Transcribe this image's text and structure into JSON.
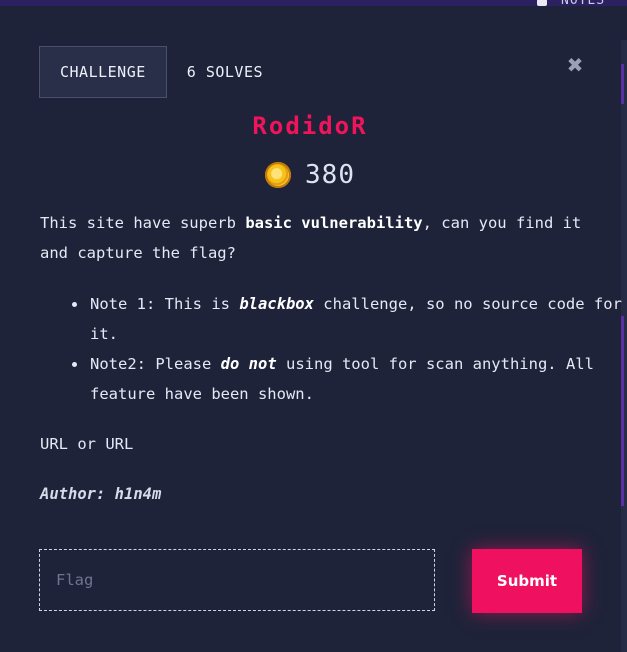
{
  "header": {
    "notes_label": "NOTES"
  },
  "tabs": [
    {
      "label": "CHALLENGE",
      "active": true
    },
    {
      "label": "6 SOLVES",
      "active": false
    }
  ],
  "close_label": "✖",
  "challenge": {
    "name": "RodidoR",
    "points": "380",
    "description": {
      "part1": "This site have superb ",
      "bold": "basic vulnerability",
      "part2": ", can you find it and capture the flag?"
    },
    "notes": [
      {
        "before": "Note 1: This is ",
        "emphasis": "blackbox",
        "after": " challenge, so no source code for it."
      },
      {
        "before": "Note2: Please ",
        "emphasis": "do not",
        "after": " using tool for scan anything. All feature have been shown."
      }
    ],
    "links": {
      "first": "URL",
      "separator": " or ",
      "second": "URL"
    },
    "author": "Author: h1n4m"
  },
  "form": {
    "flag_placeholder": "Flag",
    "submit_label": "Submit"
  },
  "colors": {
    "accent": "#f01060",
    "background": "#1e2339"
  }
}
